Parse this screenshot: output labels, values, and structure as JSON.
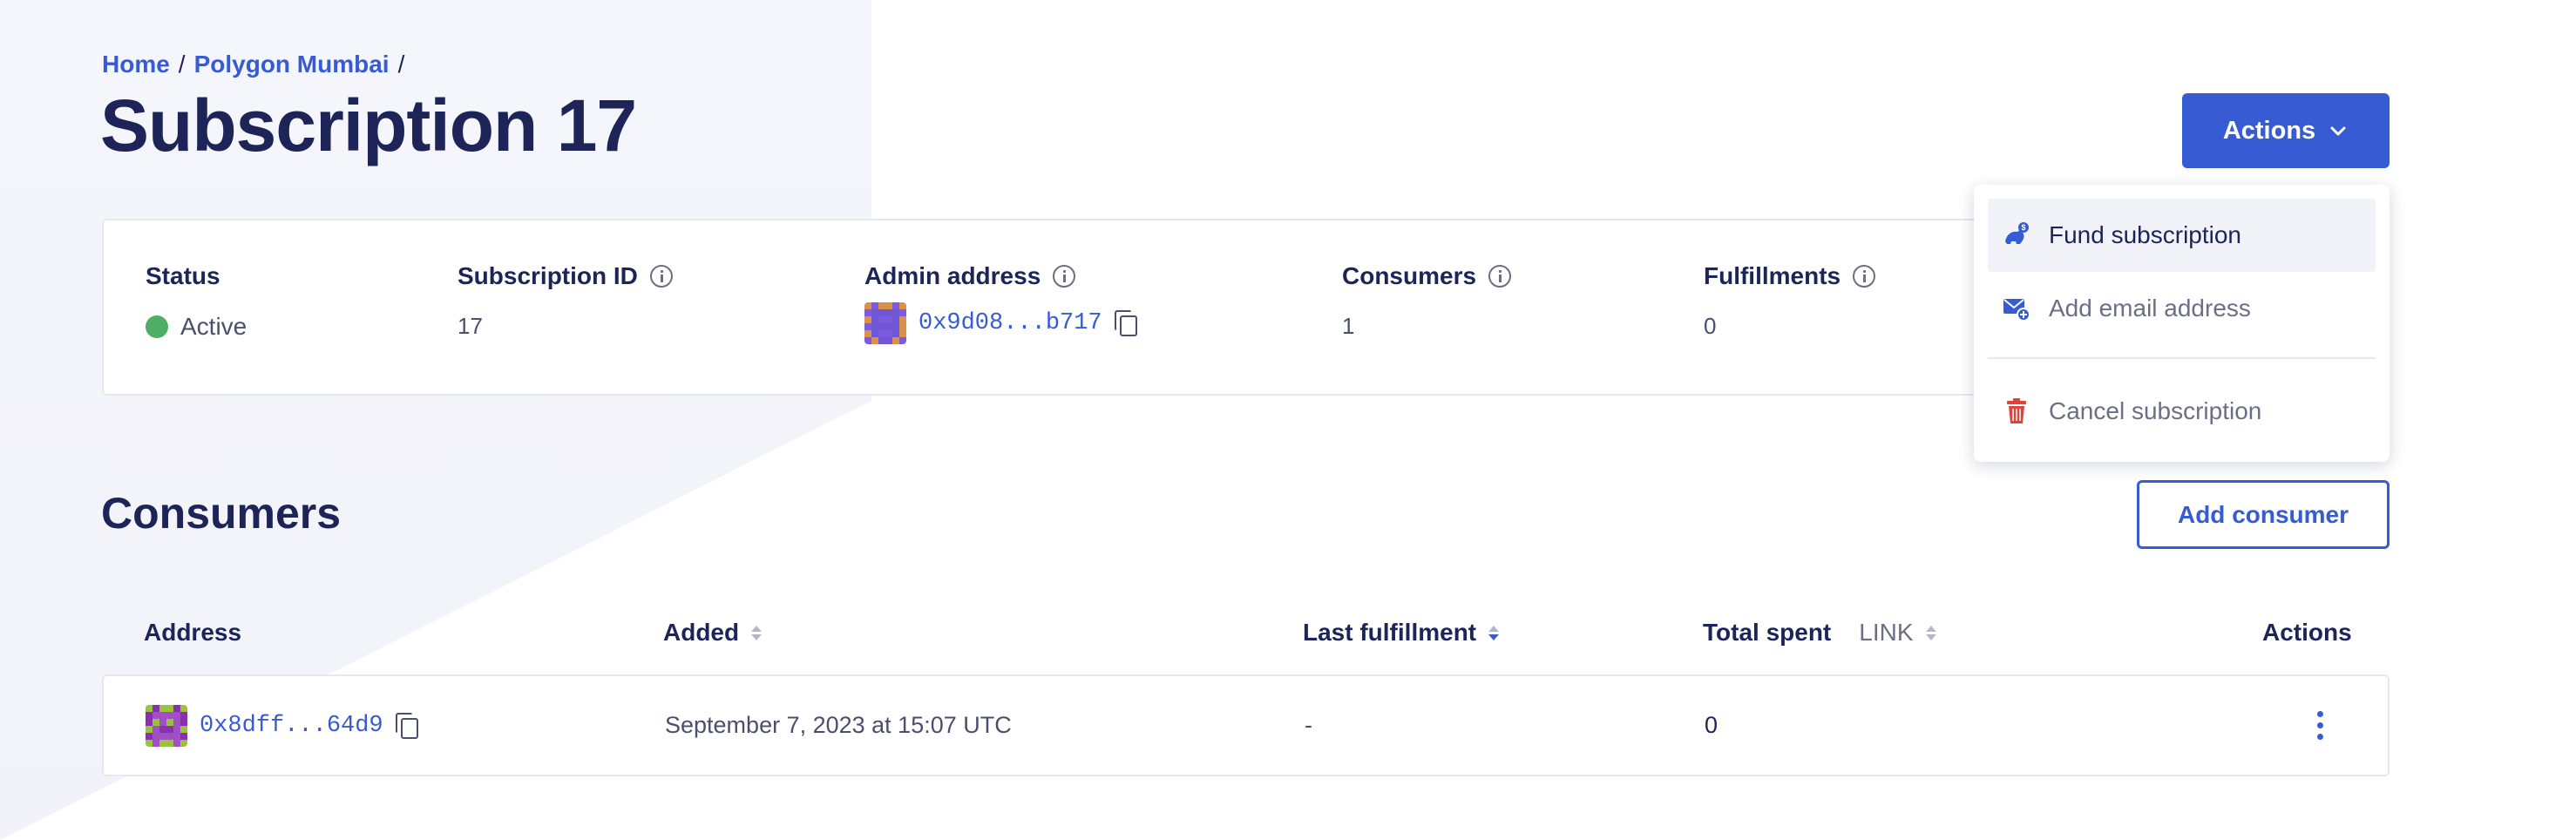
{
  "breadcrumb": {
    "home": "Home",
    "network": "Polygon Mumbai",
    "separator": "/"
  },
  "page_title": "Subscription 17",
  "actions_button": {
    "label": "Actions",
    "icon": "chevron-down-icon"
  },
  "details": {
    "status": {
      "label": "Status",
      "value": "Active",
      "color": "#4caf63"
    },
    "subscription_id": {
      "label": "Subscription ID",
      "value": "17"
    },
    "admin_address": {
      "label": "Admin address",
      "value": "0x9d08...b717"
    },
    "consumers": {
      "label": "Consumers",
      "value": "1"
    },
    "fulfillments": {
      "label": "Fulfillments",
      "value": "0"
    }
  },
  "dropdown": {
    "items": [
      {
        "label": "Fund subscription",
        "icon": "fund-icon"
      },
      {
        "label": "Add email address",
        "icon": "email-add-icon"
      },
      {
        "label": "Cancel subscription",
        "icon": "trash-icon"
      }
    ]
  },
  "consumers_section": {
    "title": "Consumers",
    "add_button": "Add consumer",
    "columns": {
      "address": "Address",
      "added": "Added",
      "last_fulfillment": "Last fulfillment",
      "total_spent": "Total spent",
      "total_spent_unit": "LINK",
      "actions": "Actions"
    },
    "rows": [
      {
        "address": "0x8dff...64d9",
        "added": "September 7, 2023 at 15:07 UTC",
        "last_fulfillment": "-",
        "total_spent": "0"
      }
    ]
  },
  "colors": {
    "accent": "#375bd2",
    "text": "#1c2458",
    "danger": "#e0433b",
    "success": "#4caf63"
  }
}
